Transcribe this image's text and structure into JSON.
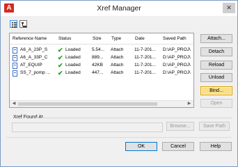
{
  "window": {
    "title": "Xref Manager",
    "app_icon_letter": "A",
    "close_glyph": "✕"
  },
  "columns": [
    "Reference Name",
    "Status",
    "Size",
    "Type",
    "Date",
    "Saved Path"
  ],
  "rows": [
    {
      "name": "A6_A_23P_S",
      "status": "Loaded",
      "size": "5.54...",
      "type": "Attach",
      "date": "11-7-201...",
      "path": "D:\\AP_PROJ\\"
    },
    {
      "name": "A6_A_33P_C",
      "status": "Loaded",
      "size": "889...",
      "type": "Attach",
      "date": "11-7-201...",
      "path": "D:\\AP_PROJ\\"
    },
    {
      "name": "AT_EQUIP",
      "status": "Loaded",
      "size": "42KB",
      "type": "Attach",
      "date": "11-7-201...",
      "path": "D:\\AP_PROJ\\"
    },
    {
      "name": "SS_7_pomp ...",
      "status": "Loaded",
      "size": "447...",
      "type": "Attach",
      "date": "11-7-201...",
      "path": "D:\\AP_PROJ\\"
    }
  ],
  "side_buttons": {
    "attach": "Attach...",
    "detach": "Detach",
    "reload": "Reload",
    "unload": "Unload",
    "bind": "Bind...",
    "open": "Open"
  },
  "found_at": {
    "label": "Xref Found At",
    "value": "",
    "browse": "Browse...",
    "save_path": "Save Path"
  },
  "footer": {
    "ok": "OK",
    "cancel": "Cancel",
    "help": "Help"
  },
  "colors": {
    "status_ok": "#1fa11f",
    "bind_focus": "#f8e08a",
    "app_icon": "#d42a1f"
  }
}
